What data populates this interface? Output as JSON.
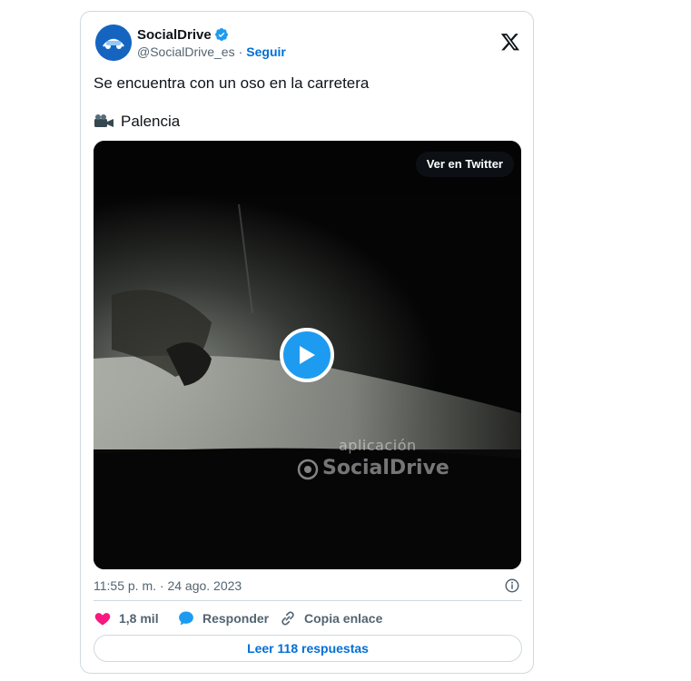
{
  "author": {
    "display_name": "SocialDrive",
    "handle": "@SocialDrive_es",
    "separator": "·",
    "follow_label": "Seguir"
  },
  "tweet": {
    "text": "Se encuentra con un oso en la carretera",
    "location": "Palencia",
    "location_icon": "video-camera-icon"
  },
  "media": {
    "view_on_twitter_label": "Ver en Twitter",
    "watermark_line1": "aplicación",
    "watermark_line2": "SocialDrive"
  },
  "meta": {
    "timestamp": "11:55 p. m. · 24 ago. 2023"
  },
  "actions": {
    "likes": "1,8 mil",
    "reply_label": "Responder",
    "copy_link_label": "Copia enlace"
  },
  "read_replies_label": "Leer 118 respuestas",
  "colors": {
    "accent": "#1d9bf0",
    "link": "#006fd6",
    "like": "#f91880",
    "text": "#0f1419",
    "muted": "#536471",
    "border": "#cfd9de"
  }
}
